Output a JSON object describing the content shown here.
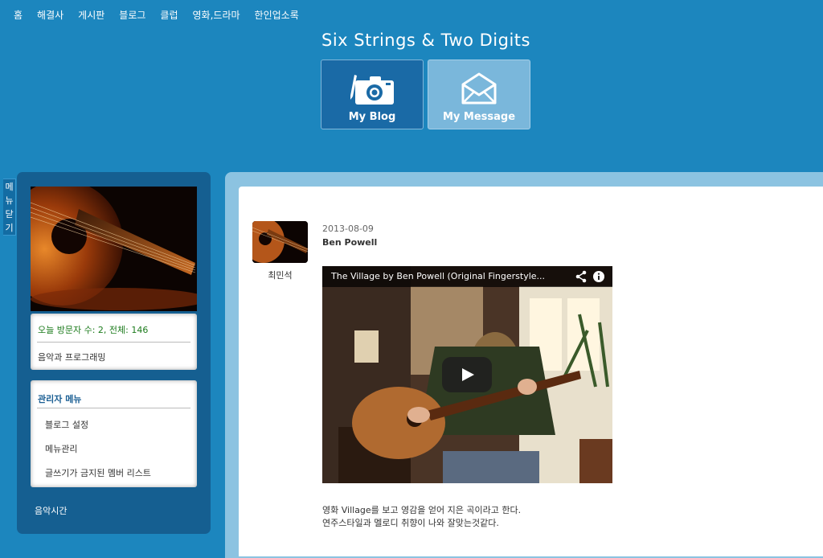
{
  "nav": [
    "홈",
    "해결사",
    "게시판",
    "블로그",
    "클럽",
    "영화,드라마",
    "한인업소록"
  ],
  "site_title": "Six Strings & Two Digits",
  "tiles": {
    "blog_label": "My Blog",
    "message_label": "My Message"
  },
  "side_tab": [
    "메",
    "뉴",
    "닫",
    "기"
  ],
  "sidebar": {
    "visit_count": "오늘 방문자 수: 2, 전체: 146",
    "blog_description": "음악과 프로그래밍",
    "admin_title": "관리자 메뉴",
    "admin_items": [
      "블로그 설정",
      "메뉴관리",
      "글쓰기가 금지된 멤버 리스트"
    ],
    "music_time": "음악시간"
  },
  "post": {
    "author": "최민석",
    "date": "2013-08-09",
    "title": "Ben Powell",
    "video_title": "The Village by Ben Powell (Original Fingerstyle...",
    "body_lines": [
      "영화 Village를 보고 영감을 얻어 지은 곡이라고 한다.",
      "연주스타일과 멜로디 취향이 나와 잘맞는것같다."
    ]
  },
  "colors": {
    "background": "#1c86be",
    "sidebar": "#155f91",
    "visit_text": "#1c7b1c",
    "admin_title": "#1a5e93"
  },
  "icons": [
    "camera-pencil-icon",
    "envelope-icon",
    "share-icon",
    "info-icon",
    "play-icon"
  ]
}
